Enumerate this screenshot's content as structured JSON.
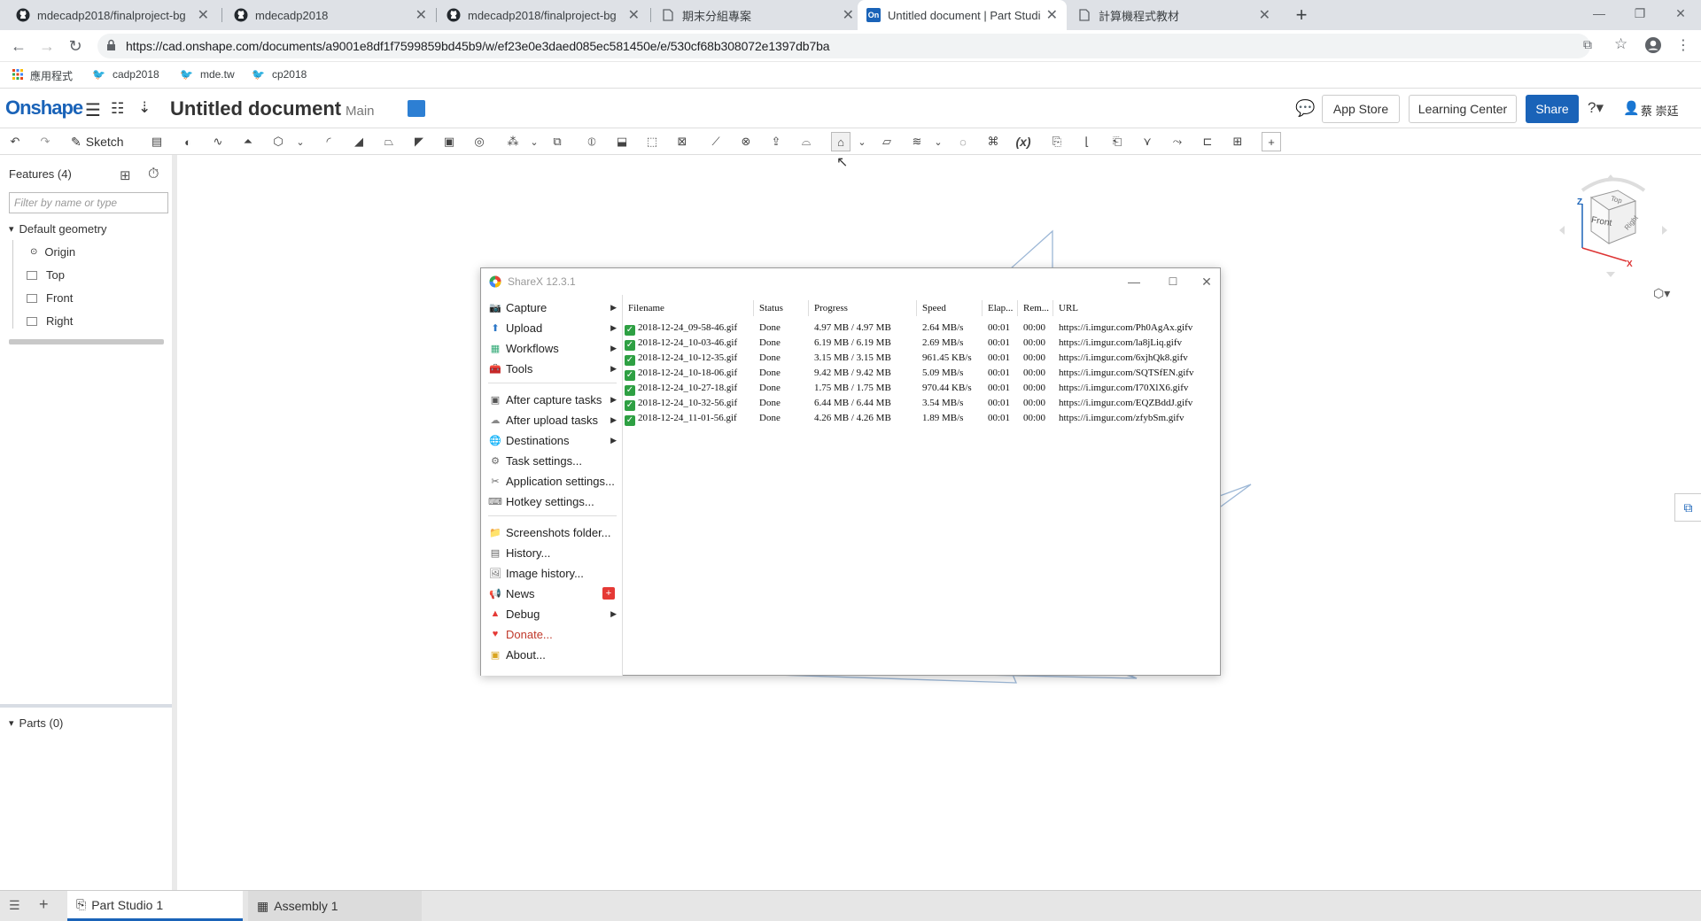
{
  "browser": {
    "tabs": [
      {
        "title": "mdecadp2018/finalproject-bg",
        "icon": "github-icon"
      },
      {
        "title": "mdecadp2018",
        "icon": "github-icon"
      },
      {
        "title": "mdecadp2018/finalproject-bg",
        "icon": "github-icon"
      },
      {
        "title": "期末分組專案",
        "icon": "document-icon"
      },
      {
        "title": "Untitled document | Part Studio",
        "icon": "onshape-icon",
        "icon_text": "On"
      },
      {
        "title": "計算機程式教材",
        "icon": "document-icon"
      }
    ],
    "url": "https://cad.onshape.com/documents/a9001e8df1f7599859bd45b9/w/ef23e0e3daed085ec581450e/e/530cf68b308072e1397db7ba",
    "bookmarks": [
      "應用程式",
      "cadp2018",
      "mde.tw",
      "cp2018"
    ]
  },
  "onshape": {
    "logo": "Onshape",
    "document_title": "Untitled document",
    "branch": "Main",
    "app_store": "App Store",
    "learning_center": "Learning Center",
    "share": "Share",
    "user": "蔡 崇廷",
    "sketch": "Sketch",
    "features_header": "Features (4)",
    "filter_placeholder": "Filter by name or type",
    "default_geometry": "Default geometry",
    "tree_items": [
      "Origin",
      "Top",
      "Front",
      "Right"
    ],
    "parts_header": "Parts (0)",
    "viewcube": {
      "front": "Front",
      "top": "Top",
      "right": "Right",
      "axis_z": "Z",
      "axis_x": "X"
    },
    "bottom_tabs": [
      "Part Studio 1",
      "Assembly 1"
    ]
  },
  "sharex": {
    "title": "ShareX 12.3.1",
    "menu": [
      {
        "label": "Capture",
        "submenu": true,
        "icon": "camera-icon"
      },
      {
        "label": "Upload",
        "submenu": true,
        "icon": "upload-arrow-icon"
      },
      {
        "label": "Workflows",
        "submenu": true,
        "icon": "workflow-grid-icon"
      },
      {
        "label": "Tools",
        "submenu": true,
        "icon": "toolbox-icon"
      },
      {
        "label": "After capture tasks",
        "submenu": true,
        "icon": "capture-tasks-icon"
      },
      {
        "label": "After upload tasks",
        "submenu": true,
        "icon": "cloud-tasks-icon"
      },
      {
        "label": "Destinations",
        "submenu": true,
        "icon": "globe-icon"
      },
      {
        "label": "Task settings...",
        "submenu": false,
        "icon": "gear-icon"
      },
      {
        "label": "Application settings...",
        "submenu": false,
        "icon": "wrench-icon"
      },
      {
        "label": "Hotkey settings...",
        "submenu": false,
        "icon": "keyboard-icon"
      },
      {
        "label": "Screenshots folder...",
        "submenu": false,
        "icon": "folder-icon"
      },
      {
        "label": "History...",
        "submenu": false,
        "icon": "history-icon"
      },
      {
        "label": "Image history...",
        "submenu": false,
        "icon": "image-icon"
      },
      {
        "label": "News",
        "submenu": false,
        "icon": "megaphone-icon",
        "badge": "+"
      },
      {
        "label": "Debug",
        "submenu": true,
        "icon": "warning-cone-icon"
      },
      {
        "label": "Donate...",
        "submenu": false,
        "icon": "heart-icon"
      },
      {
        "label": "About...",
        "submenu": false,
        "icon": "info-icon"
      }
    ],
    "columns": [
      "Filename",
      "Status",
      "Progress",
      "Speed",
      "Elap...",
      "Rem...",
      "URL"
    ],
    "rows": [
      {
        "filename": "2018-12-24_09-58-46.gif",
        "status": "Done",
        "progress": "4.97 MB / 4.97 MB",
        "speed": "2.64 MB/s",
        "elapsed": "00:01",
        "remaining": "00:00",
        "url": "https://i.imgur.com/Ph0AgAx.gifv"
      },
      {
        "filename": "2018-12-24_10-03-46.gif",
        "status": "Done",
        "progress": "6.19 MB / 6.19 MB",
        "speed": "2.69 MB/s",
        "elapsed": "00:01",
        "remaining": "00:00",
        "url": "https://i.imgur.com/la8jLiq.gifv"
      },
      {
        "filename": "2018-12-24_10-12-35.gif",
        "status": "Done",
        "progress": "3.15 MB / 3.15 MB",
        "speed": "961.45 KB/s",
        "elapsed": "00:01",
        "remaining": "00:00",
        "url": "https://i.imgur.com/6xjhQk8.gifv"
      },
      {
        "filename": "2018-12-24_10-18-06.gif",
        "status": "Done",
        "progress": "9.42 MB / 9.42 MB",
        "speed": "5.09 MB/s",
        "elapsed": "00:01",
        "remaining": "00:00",
        "url": "https://i.imgur.com/SQTSfEN.gifv"
      },
      {
        "filename": "2018-12-24_10-27-18.gif",
        "status": "Done",
        "progress": "1.75 MB / 1.75 MB",
        "speed": "970.44 KB/s",
        "elapsed": "00:01",
        "remaining": "00:00",
        "url": "https://i.imgur.com/I70XlX6.gifv"
      },
      {
        "filename": "2018-12-24_10-32-56.gif",
        "status": "Done",
        "progress": "6.44 MB / 6.44 MB",
        "speed": "3.54 MB/s",
        "elapsed": "00:01",
        "remaining": "00:00",
        "url": "https://i.imgur.com/EQZBddJ.gifv"
      },
      {
        "filename": "2018-12-24_11-01-56.gif",
        "status": "Done",
        "progress": "4.26 MB / 4.26 MB",
        "speed": "1.89 MB/s",
        "elapsed": "00:01",
        "remaining": "00:00",
        "url": "https://i.imgur.com/zfybSm.gifv"
      }
    ]
  },
  "colors": {
    "onshape_blue": "#1a63b8",
    "done_green": "#2ea043",
    "plane_stroke": "#9cb7d6"
  }
}
